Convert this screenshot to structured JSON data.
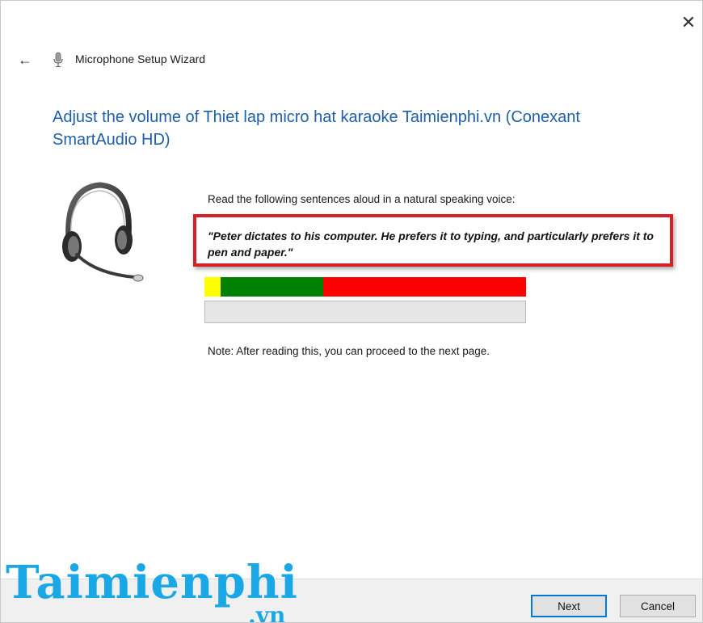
{
  "window": {
    "title": "Microphone Setup Wizard",
    "close_glyph": "✕",
    "back_glyph": "←"
  },
  "content": {
    "heading": "Adjust the volume of Thiet lap micro hat karaoke Taimienphi.vn (Conexant SmartAudio HD)",
    "instructions": "Read the following sentences aloud in a natural speaking voice:",
    "quote": "\"Peter dictates to his computer. He prefers it to typing, and particularly prefers it to pen and paper.\"",
    "note": "Note: After reading this, you can proceed to the next page."
  },
  "volume_meter": {
    "segments": [
      {
        "color": "#ffff00",
        "fraction": 0.05
      },
      {
        "color": "#008000",
        "fraction": 0.32
      },
      {
        "color": "#ff0000",
        "fraction": 0.63
      }
    ]
  },
  "progress": {
    "fraction": 0
  },
  "buttons": {
    "next_label": "Next",
    "cancel_label": "Cancel"
  },
  "watermark": {
    "main": "Taimienphi",
    "suffix": ".vn"
  },
  "colors": {
    "heading": "#1f5fa9",
    "highlight_border": "#d42027",
    "watermark": "#1aa7e6",
    "default_button_border": "#0078d7"
  },
  "icons": [
    "close-icon",
    "back-arrow-icon",
    "microphone-icon",
    "headset-illustration"
  ]
}
